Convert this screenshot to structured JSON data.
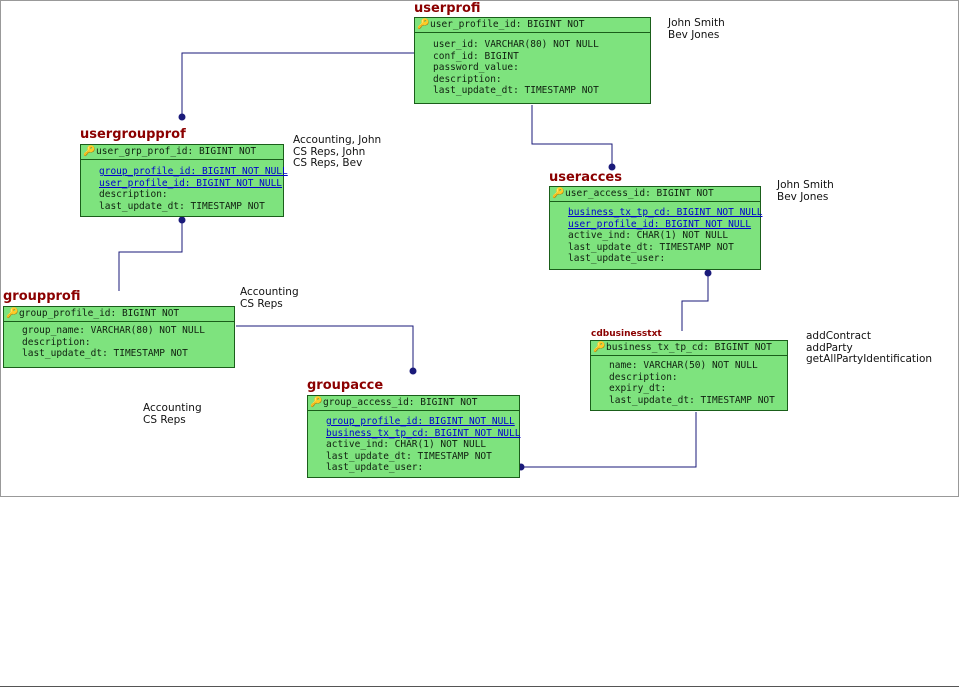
{
  "entities": {
    "userprofi": {
      "title": "userprofi",
      "pk": "user_profile_id: BIGINT NOT",
      "columns": [
        "user_id: VARCHAR(80) NOT NULL",
        "conf_id: BIGINT",
        "password_value:",
        "description:",
        "last_update_dt: TIMESTAMP NOT"
      ],
      "fk": [
        false,
        false,
        false,
        false,
        false
      ]
    },
    "usergroupprof": {
      "title": "usergroupprof",
      "pk": "user_grp_prof_id: BIGINT NOT",
      "columns": [
        "group_profile_id: BIGINT NOT NULL",
        "user_profile_id: BIGINT NOT NULL",
        "description:",
        "last_update_dt: TIMESTAMP NOT"
      ],
      "fk": [
        true,
        true,
        false,
        false
      ]
    },
    "useracces": {
      "title": "useracces",
      "pk": "user_access_id: BIGINT NOT",
      "columns": [
        "business_tx_tp_cd: BIGINT NOT NULL",
        "user_profile_id: BIGINT NOT NULL",
        "active_ind: CHAR(1) NOT NULL",
        "last_update_dt: TIMESTAMP NOT",
        "last_update_user:"
      ],
      "fk": [
        true,
        true,
        false,
        false,
        false
      ]
    },
    "groupprofi": {
      "title": "groupprofi",
      "pk": "group_profile_id: BIGINT NOT",
      "columns": [
        "group_name: VARCHAR(80) NOT NULL",
        "description:",
        "last_update_dt: TIMESTAMP NOT"
      ],
      "fk": [
        false,
        false,
        false
      ]
    },
    "cdbusinesstxt": {
      "title": "cdbusinesstxt",
      "pk": "business_tx_tp_cd: BIGINT NOT",
      "columns": [
        "name: VARCHAR(50) NOT NULL",
        "description:",
        "expiry_dt:",
        "last_update_dt: TIMESTAMP NOT"
      ],
      "fk": [
        false,
        false,
        false,
        false
      ]
    },
    "groupacce": {
      "title": "groupacce",
      "pk": "group_access_id: BIGINT NOT",
      "columns": [
        "group_profile_id: BIGINT NOT NULL",
        "business_tx_tp_cd: BIGINT NOT NULL",
        "active_ind: CHAR(1) NOT NULL",
        "last_update_dt: TIMESTAMP NOT",
        "last_update_user:"
      ],
      "fk": [
        true,
        true,
        false,
        false,
        false
      ]
    }
  },
  "notes": {
    "userprofi": [
      "John Smith",
      "Bev Jones"
    ],
    "usergroupprof": [
      "Accounting, John",
      "CS Reps, John",
      "CS Reps, Bev"
    ],
    "useracces": [
      "John Smith",
      "Bev Jones"
    ],
    "groupprofi": [
      "Accounting",
      "CS Reps"
    ],
    "groupacce": [
      "Accounting",
      "CS Reps"
    ],
    "cdbusinesstxt": [
      "addContract",
      "addParty",
      "getAllPartyIdentification"
    ]
  },
  "icons": {
    "primary_key": "key-icon"
  },
  "colors": {
    "entity_fill": "#7ee37e",
    "entity_border": "#1a5e1a",
    "title": "#8b0000",
    "connector": "#1a1a7a",
    "foreign_key": "#0000cc"
  }
}
